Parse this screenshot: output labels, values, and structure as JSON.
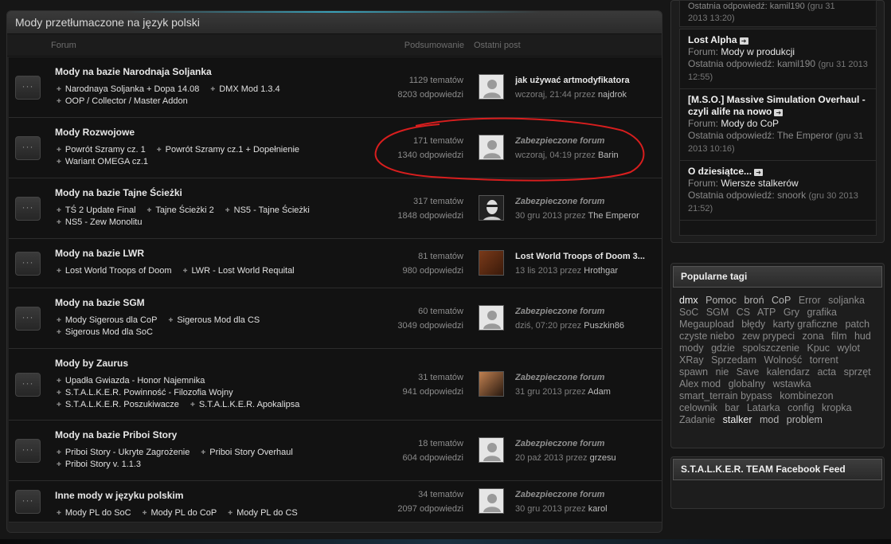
{
  "panel": {
    "title": "Mody przetłumaczone na język polski",
    "col_forum": "Forum",
    "col_summary": "Podsumowanie",
    "col_last": "Ostatni post"
  },
  "rows": [
    {
      "title": "Mody na bazie Narodnaja Soljanka",
      "subs": [
        "Narodnaya Soljanka + Dopa 14.08",
        "DMX Mod 1.3.4",
        "OOP / Collector / Master Addon"
      ],
      "topics": "1129 tematów",
      "replies": "8203 odpowiedzi",
      "last_title": "jak używać artmodyfikatora",
      "last_date": "wczoraj, 21:44",
      "by": "przez",
      "last_user": "najdrok"
    },
    {
      "title": "Mody Rozwojowe",
      "subs": [
        "Powrót Szramy cz. 1",
        "Powrót Szramy cz.1 + Dopełnienie",
        "Wariant OMEGA cz.1"
      ],
      "topics": "171 tematów",
      "replies": "1340 odpowiedzi",
      "last_title": "Zabezpieczone forum",
      "last_date": "wczoraj, 04:19",
      "by": "przez",
      "last_user": "Barin"
    },
    {
      "title": "Mody na bazie Tajne Ścieżki",
      "subs": [
        "TŚ 2 Update Final",
        "Tajne Ścieżki 2",
        "NS5 - Tajne Ścieżki",
        "NS5 - Zew Monolitu"
      ],
      "topics": "317 tematów",
      "replies": "1848 odpowiedzi",
      "last_title": "Zabezpieczone forum",
      "last_date": "30 gru 2013",
      "by": "przez",
      "last_user": "The Emperor"
    },
    {
      "title": "Mody na bazie LWR",
      "subs": [
        "Lost World Troops of Doom",
        "LWR - Lost World Requital"
      ],
      "topics": "81 tematów",
      "replies": "980 odpowiedzi",
      "last_title": "Lost World Troops of Doom 3...",
      "last_date": "13 lis 2013",
      "by": "przez",
      "last_user": "Hrothgar"
    },
    {
      "title": "Mody na bazie SGM",
      "subs": [
        "Mody Sigerous dla CoP",
        "Sigerous Mod dla CS",
        "Sigerous Mod dla SoC"
      ],
      "topics": "60 tematów",
      "replies": "3049 odpowiedzi",
      "last_title": "Zabezpieczone forum",
      "last_date": "dziś, 07:20",
      "by": "przez",
      "last_user": "Puszkin86"
    },
    {
      "title": "Mody by Zaurus",
      "subs": [
        "Upadła Gwiazda - Honor Najemnika",
        "S.T.A.L.K.E.R. Powinność - Filozofia Wojny",
        "S.T.A.L.K.E.R. Poszukiwacze",
        "S.T.A.L.K.E.R. Apokalipsa"
      ],
      "topics": "31 tematów",
      "replies": "941 odpowiedzi",
      "last_title": "Zabezpieczone forum",
      "last_date": "31 gru 2013",
      "by": "przez",
      "last_user": "Adam"
    },
    {
      "title": "Mody na bazie Priboi Story",
      "subs": [
        "Priboi Story - Ukryte Zagrożenie",
        "Priboi Story Overhaul",
        "Priboi Story v. 1.1.3"
      ],
      "topics": "18 tematów",
      "replies": "604 odpowiedzi",
      "last_title": "Zabezpieczone forum",
      "last_date": "20 paź 2013",
      "by": "przez",
      "last_user": "grzesu"
    },
    {
      "title": "Inne mody w języku polskim",
      "subs": [
        "Mody PL do SoC",
        "Mody PL do CoP",
        "Mody PL do CS"
      ],
      "topics": "34 tematów",
      "replies": "2097 odpowiedzi",
      "last_title": "Zabezpieczone forum",
      "last_date": "30 gru 2013",
      "by": "przez",
      "last_user": "karol"
    }
  ],
  "sidebar": {
    "top_fragment_1": "Ostatnia odpowiedź: kamil190",
    "top_fragment_1_date": "(gru 31",
    "top_fragment_2": "2013 13:20)",
    "recent": [
      {
        "title": "Lost Alpha",
        "forum_label": "Forum:",
        "forum": "Mody w produkcji",
        "reply_label": "Ostatnia odpowiedź:",
        "reply_user": "kamil190",
        "date": "(gru 31 2013 12:55)"
      },
      {
        "title": "[M.S.O.] Massive Simulation Overhaul - czyli alife na nowo",
        "forum_label": "Forum:",
        "forum": "Mody do CoP",
        "reply_label": "Ostatnia odpowiedź:",
        "reply_user": "The Emperor",
        "date": "(gru 31 2013 10:16)"
      },
      {
        "title": "O dziesiątce...",
        "forum_label": "Forum:",
        "forum": "Wiersze stalkerów",
        "reply_label": "Ostatnia odpowiedź:",
        "reply_user": "snoork",
        "date": "(gru 30 2013 21:52)"
      }
    ],
    "tags_title": "Popularne tagi",
    "tags": [
      {
        "t": "dmx",
        "k": "hot"
      },
      {
        "t": "Pomoc",
        "k": "warm"
      },
      {
        "t": "broń",
        "k": "warm"
      },
      {
        "t": "CoP",
        "k": "warm"
      },
      {
        "t": "Error",
        "k": ""
      },
      {
        "t": "soljanka",
        "k": ""
      },
      {
        "t": "SoC",
        "k": ""
      },
      {
        "t": "SGM",
        "k": ""
      },
      {
        "t": "CS",
        "k": ""
      },
      {
        "t": "ATP",
        "k": ""
      },
      {
        "t": "Gry",
        "k": ""
      },
      {
        "t": "grafika",
        "k": ""
      },
      {
        "t": "Megaupload",
        "k": ""
      },
      {
        "t": "błędy",
        "k": ""
      },
      {
        "t": "karty graficzne",
        "k": ""
      },
      {
        "t": "patch",
        "k": ""
      },
      {
        "t": "czyste niebo",
        "k": ""
      },
      {
        "t": "zew prypeci",
        "k": ""
      },
      {
        "t": "zona",
        "k": ""
      },
      {
        "t": "film",
        "k": ""
      },
      {
        "t": "hud",
        "k": ""
      },
      {
        "t": "mody",
        "k": ""
      },
      {
        "t": "gdzie",
        "k": ""
      },
      {
        "t": "spolszczenie",
        "k": ""
      },
      {
        "t": "Kpuc",
        "k": ""
      },
      {
        "t": "wylot",
        "k": ""
      },
      {
        "t": "XRay",
        "k": ""
      },
      {
        "t": "Sprzedam",
        "k": ""
      },
      {
        "t": "Wolność",
        "k": ""
      },
      {
        "t": "torrent",
        "k": ""
      },
      {
        "t": "spawn",
        "k": ""
      },
      {
        "t": "nie",
        "k": ""
      },
      {
        "t": "Save",
        "k": ""
      },
      {
        "t": "kalendarz",
        "k": ""
      },
      {
        "t": "acta",
        "k": ""
      },
      {
        "t": "sprzęt",
        "k": ""
      },
      {
        "t": "Alex mod",
        "k": ""
      },
      {
        "t": "globalny",
        "k": ""
      },
      {
        "t": "wstawka",
        "k": ""
      },
      {
        "t": "smart_terrain bypass",
        "k": ""
      },
      {
        "t": "kombinezon",
        "k": ""
      },
      {
        "t": "celownik",
        "k": ""
      },
      {
        "t": "bar",
        "k": ""
      },
      {
        "t": "Latarka",
        "k": ""
      },
      {
        "t": "config",
        "k": ""
      },
      {
        "t": "kropka",
        "k": ""
      },
      {
        "t": "Zadanie",
        "k": ""
      },
      {
        "t": "stalker",
        "k": "hot"
      },
      {
        "t": "mod",
        "k": "warm"
      },
      {
        "t": "problem",
        "k": "warm"
      }
    ],
    "fb_title": "S.T.A.L.K.E.R. TEAM Facebook Feed"
  },
  "colors": {
    "annotation": "#d81e1e",
    "accent_glow": "#3aa0b8"
  }
}
